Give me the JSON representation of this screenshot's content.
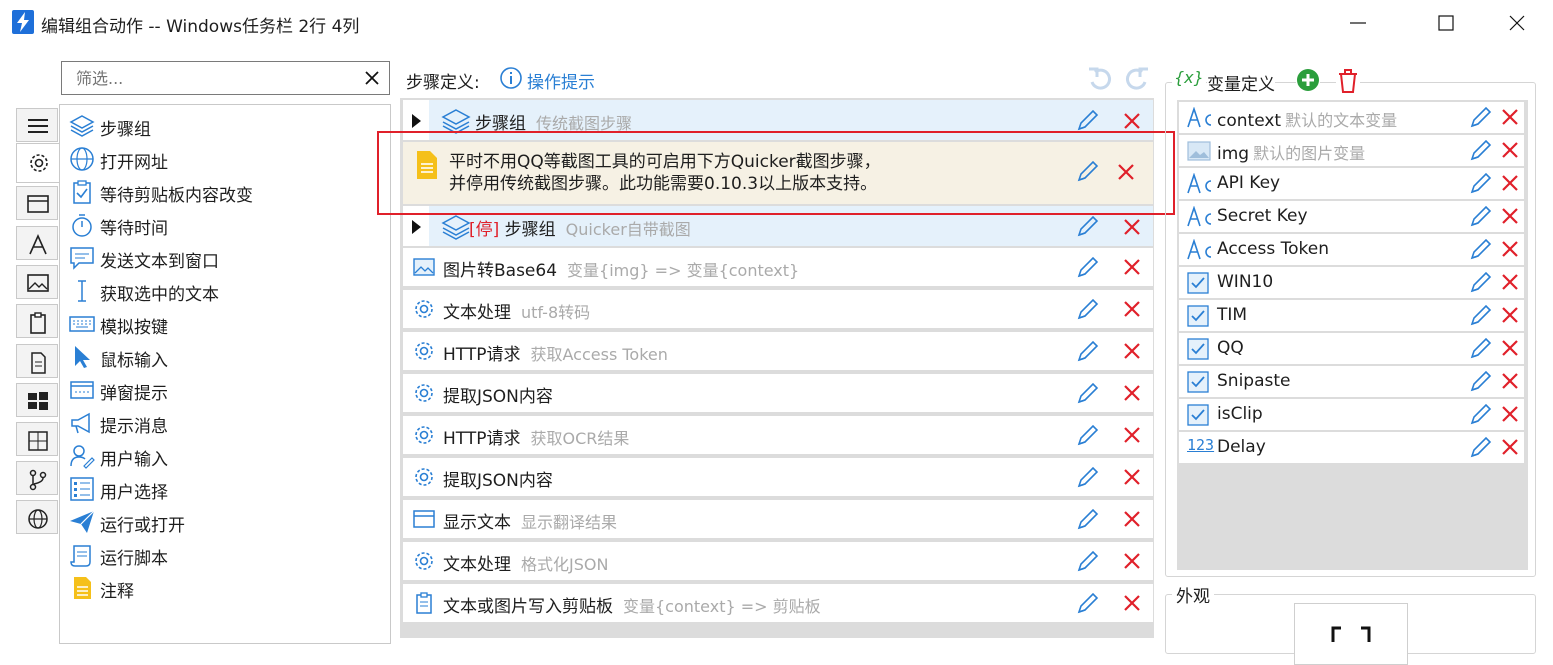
{
  "window": {
    "title": "编辑组合动作 -- Windows任务栏 2行 4列",
    "controls": [
      "minimize",
      "maximize",
      "close"
    ]
  },
  "colors": {
    "accent": "#2a7fd4",
    "delete": "#e0202a",
    "paused": "#e0202a",
    "add": "#2b9e3c",
    "note_bg": "#f6f1e4",
    "group_bg": "#e5f1fb"
  },
  "sidebar": {
    "tabs": [
      {
        "icon": "menu-icon"
      },
      {
        "icon": "gear-icon",
        "active": true
      },
      {
        "icon": "window-icon"
      },
      {
        "icon": "letter-a-icon"
      },
      {
        "icon": "image-icon"
      },
      {
        "icon": "clipboard-icon"
      },
      {
        "icon": "document-icon"
      },
      {
        "icon": "windows-icon"
      },
      {
        "icon": "calculator-icon"
      },
      {
        "icon": "branch-icon"
      },
      {
        "icon": "globe-icon"
      }
    ],
    "filter": {
      "placeholder": "筛选..."
    },
    "items": [
      {
        "label": "步骤组",
        "icon": "layers-icon"
      },
      {
        "label": "打开网址",
        "icon": "globe-icon"
      },
      {
        "label": "等待剪贴板内容改变",
        "icon": "clipboard-check-icon"
      },
      {
        "label": "等待时间",
        "icon": "stopwatch-icon"
      },
      {
        "label": "发送文本到窗口",
        "icon": "chat-icon"
      },
      {
        "label": "获取选中的文本",
        "icon": "text-cursor-icon"
      },
      {
        "label": "模拟按键",
        "icon": "keyboard-icon"
      },
      {
        "label": "鼠标输入",
        "icon": "mouse-pointer-icon"
      },
      {
        "label": "弹窗提示",
        "icon": "popup-icon"
      },
      {
        "label": "提示消息",
        "icon": "megaphone-icon"
      },
      {
        "label": "用户输入",
        "icon": "user-edit-icon"
      },
      {
        "label": "用户选择",
        "icon": "checklist-icon"
      },
      {
        "label": "运行或打开",
        "icon": "paper-plane-icon"
      },
      {
        "label": "运行脚本",
        "icon": "scroll-icon"
      },
      {
        "label": "注释",
        "icon": "note-icon"
      }
    ]
  },
  "steps": {
    "header": "步骤定义:",
    "help_label": "操作提示",
    "rows": [
      {
        "kind": "group",
        "name": "步骤组",
        "desc": "传统截图步骤",
        "paused": false
      },
      {
        "kind": "note",
        "text_line1": "平时不用QQ等截图工具的可启用下方Quicker截图步骤，",
        "text_line2": "并停用传统截图步骤。此功能需要0.10.3以上版本支持。"
      },
      {
        "kind": "group",
        "name": "步骤组",
        "desc": "Quicker自带截图",
        "paused": true,
        "paused_tag": "[停]"
      },
      {
        "kind": "step",
        "icon": "image-icon",
        "name": "图片转Base64",
        "desc": "变量{img} => 变量{context}"
      },
      {
        "kind": "step",
        "icon": "gear-icon",
        "name": "文本处理",
        "desc": "utf-8转码"
      },
      {
        "kind": "step",
        "icon": "gear-icon",
        "name": "HTTP请求",
        "desc": "获取Access Token"
      },
      {
        "kind": "step",
        "icon": "gear-icon",
        "name": "提取JSON内容",
        "desc": ""
      },
      {
        "kind": "step",
        "icon": "gear-icon",
        "name": "HTTP请求",
        "desc": "获取OCR结果"
      },
      {
        "kind": "step",
        "icon": "gear-icon",
        "name": "提取JSON内容",
        "desc": ""
      },
      {
        "kind": "step",
        "icon": "window-icon",
        "name": "显示文本",
        "desc": "显示翻译结果"
      },
      {
        "kind": "step",
        "icon": "gear-icon",
        "name": "文本处理",
        "desc": "格式化JSON"
      },
      {
        "kind": "step",
        "icon": "clipboard-icon",
        "name": "文本或图片写入剪贴板",
        "desc": "变量{context} => 剪贴板"
      }
    ]
  },
  "variables": {
    "header_symbol": "{x}",
    "header": "变量定义",
    "items": [
      {
        "type": "text",
        "name": "context",
        "desc": "默认的文本变量"
      },
      {
        "type": "image",
        "name": "img",
        "desc": "默认的图片变量"
      },
      {
        "type": "text",
        "name": "API Key",
        "desc": ""
      },
      {
        "type": "text",
        "name": "Secret Key",
        "desc": ""
      },
      {
        "type": "text",
        "name": "Access Token",
        "desc": ""
      },
      {
        "type": "bool",
        "name": "WIN10",
        "desc": ""
      },
      {
        "type": "bool",
        "name": "TIM",
        "desc": ""
      },
      {
        "type": "bool",
        "name": "QQ",
        "desc": ""
      },
      {
        "type": "bool",
        "name": "Snipaste",
        "desc": ""
      },
      {
        "type": "bool",
        "name": "isClip",
        "desc": ""
      },
      {
        "type": "number",
        "name": "Delay",
        "desc": "",
        "type_label": "123"
      }
    ]
  },
  "appearance": {
    "title": "外观"
  }
}
